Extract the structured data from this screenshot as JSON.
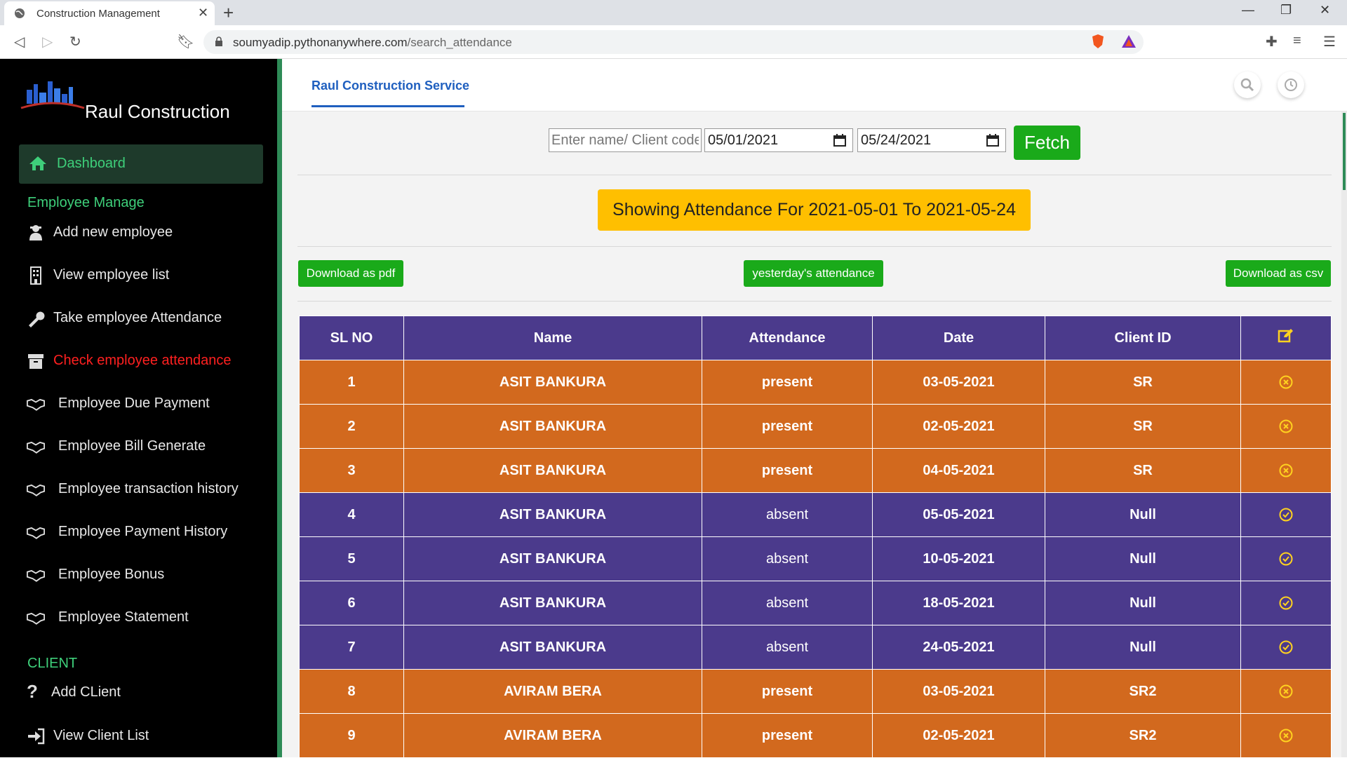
{
  "browser": {
    "tab_title": "Construction Management",
    "url_host": "soumyadip.pythonanywhere.com",
    "url_path": "/search_attendance"
  },
  "sidebar": {
    "brand": "Raul Construction",
    "logo_text": "Raul Construction",
    "active_item": "Dashboard",
    "section_employee": "Employee Manage",
    "employee_items": [
      {
        "label": "Add new employee",
        "icon": "user-secret-icon"
      },
      {
        "label": "View employee list",
        "icon": "building-icon"
      },
      {
        "label": "Take employee Attendance",
        "icon": "wrench-icon"
      },
      {
        "label": "Check employee attendance",
        "icon": "archive-icon",
        "highlight": "#ff2020"
      },
      {
        "label": "Employee Due Payment",
        "icon": "handshake-icon"
      },
      {
        "label": "Employee Bill Generate",
        "icon": "handshake-icon"
      },
      {
        "label": "Employee transaction history",
        "icon": "handshake-icon"
      },
      {
        "label": "Employee Payment History",
        "icon": "handshake-icon"
      },
      {
        "label": "Employee Bonus",
        "icon": "handshake-icon"
      },
      {
        "label": "Employee Statement",
        "icon": "handshake-icon"
      }
    ],
    "section_client": "CLIENT",
    "client_items": [
      {
        "label": "Add CLient",
        "icon": "question-icon"
      },
      {
        "label": "View Client List",
        "icon": "sign-in-icon"
      }
    ]
  },
  "topbar": {
    "title": "Raul Construction Service"
  },
  "filters": {
    "name_placeholder": "Enter name/ Client code",
    "from_date": "05/01/2021",
    "to_date": "05/24/2021",
    "fetch_label": "Fetch"
  },
  "banner": "Showing Attendance For 2021-05-01 To 2021-05-24",
  "actions": {
    "pdf": "Download as pdf",
    "yesterday": "yesterday's attendance",
    "csv": "Download as csv"
  },
  "table": {
    "headers": [
      "SL NO",
      "Name",
      "Attendance",
      "Date",
      "Client ID"
    ],
    "edit_icon": "edit-icon",
    "rows": [
      {
        "sl": "1",
        "name": "ASIT BANKURA",
        "attendance": "present",
        "date": "03-05-2021",
        "client": "SR",
        "status_icon": "times-circle-icon"
      },
      {
        "sl": "2",
        "name": "ASIT BANKURA",
        "attendance": "present",
        "date": "02-05-2021",
        "client": "SR",
        "status_icon": "times-circle-icon"
      },
      {
        "sl": "3",
        "name": "ASIT BANKURA",
        "attendance": "present",
        "date": "04-05-2021",
        "client": "SR",
        "status_icon": "times-circle-icon"
      },
      {
        "sl": "4",
        "name": "ASIT BANKURA",
        "attendance": "absent",
        "date": "05-05-2021",
        "client": "Null",
        "status_icon": "check-circle-icon"
      },
      {
        "sl": "5",
        "name": "ASIT BANKURA",
        "attendance": "absent",
        "date": "10-05-2021",
        "client": "Null",
        "status_icon": "check-circle-icon"
      },
      {
        "sl": "6",
        "name": "ASIT BANKURA",
        "attendance": "absent",
        "date": "18-05-2021",
        "client": "Null",
        "status_icon": "check-circle-icon"
      },
      {
        "sl": "7",
        "name": "ASIT BANKURA",
        "attendance": "absent",
        "date": "24-05-2021",
        "client": "Null",
        "status_icon": "check-circle-icon"
      },
      {
        "sl": "8",
        "name": "AVIRAM BERA",
        "attendance": "present",
        "date": "03-05-2021",
        "client": "SR2",
        "status_icon": "times-circle-icon"
      },
      {
        "sl": "9",
        "name": "AVIRAM BERA",
        "attendance": "present",
        "date": "02-05-2021",
        "client": "SR2",
        "status_icon": "times-circle-icon"
      }
    ]
  },
  "colors": {
    "present_row": "#d2691e",
    "absent_row": "#4b3a8c",
    "accent_green": "#1aaa1a",
    "sidebar_green": "#3ecf7a",
    "banner": "#ffbf00",
    "status_icon": "#ffd21f"
  }
}
